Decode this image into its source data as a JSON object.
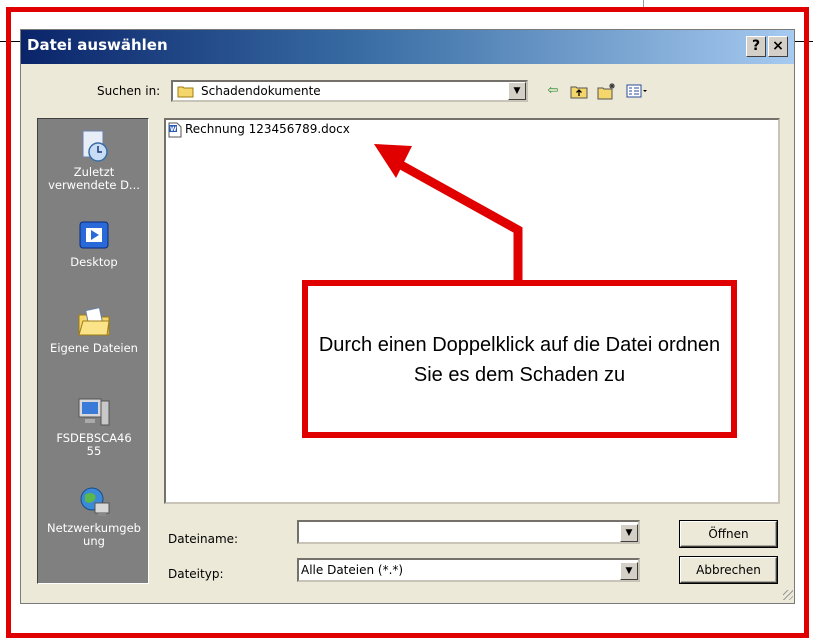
{
  "dialog": {
    "title": "Datei auswählen",
    "help_label": "?",
    "close_label": "×"
  },
  "toolbar": {
    "look_in_label": "Suchen in:",
    "look_in_value": "Schadendokumente",
    "icons": [
      "back-arrow-icon",
      "up-folder-icon",
      "new-folder-icon",
      "view-menu-icon"
    ]
  },
  "places": [
    {
      "label": "Zuletzt verwendete D...",
      "icon": "recent-documents-icon"
    },
    {
      "label": "Desktop",
      "icon": "desktop-icon"
    },
    {
      "label": "Eigene Dateien",
      "icon": "my-documents-icon"
    },
    {
      "label": "FSDEBSCA4655",
      "icon": "my-computer-icon"
    },
    {
      "label": "Netzwerkumgebung",
      "icon": "network-icon"
    }
  ],
  "files": [
    {
      "name": "Rechnung 123456789.docx",
      "icon": "word-document-icon"
    }
  ],
  "file_name": {
    "label": "Dateiname:",
    "value": ""
  },
  "file_type": {
    "label": "Dateityp:",
    "value": "Alle Dateien (*.*)"
  },
  "buttons": {
    "open": "Öffnen",
    "cancel": "Abbrechen"
  },
  "annotation": {
    "text": "Durch einen Doppelklick auf die Datei ordnen Sie es dem Schaden zu",
    "color": "#e00000"
  }
}
